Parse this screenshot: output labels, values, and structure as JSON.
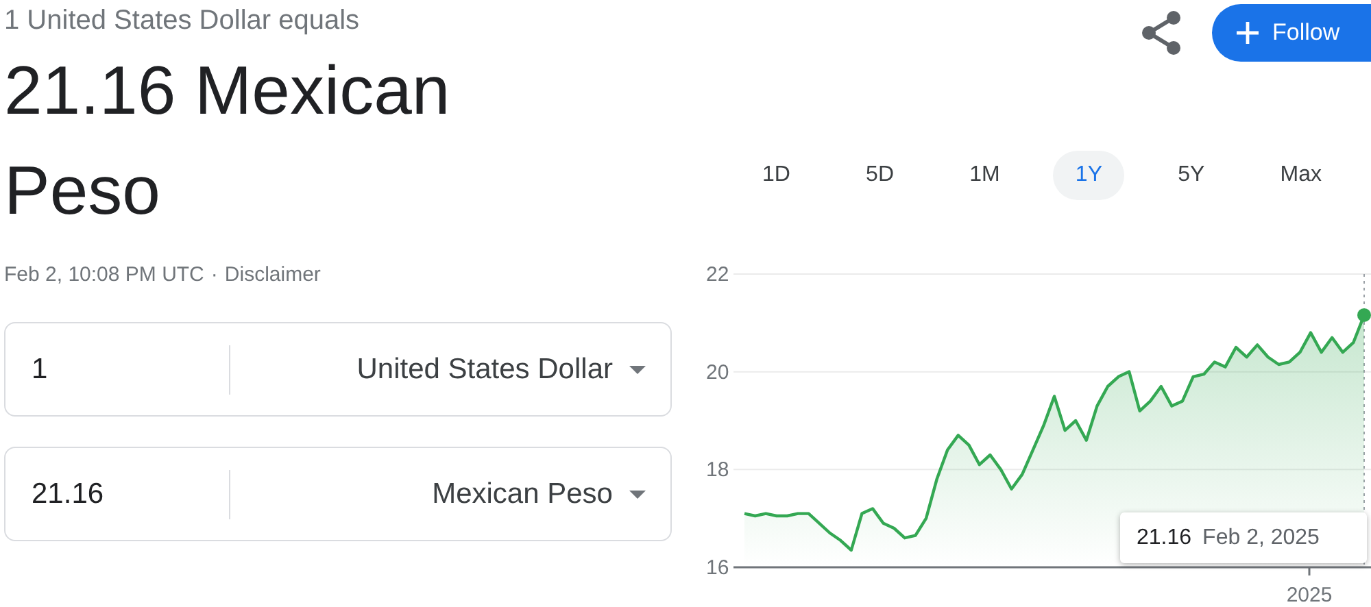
{
  "header": {
    "subtitle": "1 United States Dollar equals",
    "result": "21.16 Mexican Peso",
    "timestamp": "Feb 2, 10:08 PM UTC",
    "separator": "·",
    "disclaimer": "Disclaimer"
  },
  "follow_button": {
    "label": "Follow"
  },
  "converter": [
    {
      "amount": "1",
      "currency": "United States Dollar"
    },
    {
      "amount": "21.16",
      "currency": "Mexican Peso"
    }
  ],
  "ranges": [
    {
      "label": "1D",
      "selected": false
    },
    {
      "label": "5D",
      "selected": false
    },
    {
      "label": "1M",
      "selected": false
    },
    {
      "label": "1Y",
      "selected": true
    },
    {
      "label": "5Y",
      "selected": false
    },
    {
      "label": "Max",
      "selected": false
    }
  ],
  "chart": {
    "tooltip": {
      "value": "21.16",
      "date": "Feb 2, 2025"
    },
    "chart_data": {
      "type": "area",
      "ylim": [
        16,
        22
      ],
      "yticks": [
        16,
        18,
        20,
        22
      ],
      "annotations": [
        {
          "text": "2025"
        }
      ],
      "series": [
        {
          "color": "#34a853",
          "values": [
            17.1,
            17.05,
            17.1,
            17.05,
            17.05,
            17.1,
            17.1,
            16.9,
            16.7,
            16.55,
            16.35,
            17.1,
            17.2,
            16.9,
            16.8,
            16.6,
            16.65,
            17.0,
            17.8,
            18.4,
            18.7,
            18.5,
            18.1,
            18.3,
            18.0,
            17.6,
            17.9,
            18.4,
            18.9,
            19.5,
            18.8,
            19.0,
            18.6,
            19.3,
            19.7,
            19.9,
            20.0,
            19.2,
            19.4,
            19.7,
            19.3,
            19.4,
            19.9,
            19.95,
            20.2,
            20.1,
            20.5,
            20.3,
            20.55,
            20.3,
            20.15,
            20.2,
            20.4,
            20.8,
            20.4,
            20.7,
            20.4,
            20.6,
            21.16
          ]
        }
      ]
    }
  }
}
